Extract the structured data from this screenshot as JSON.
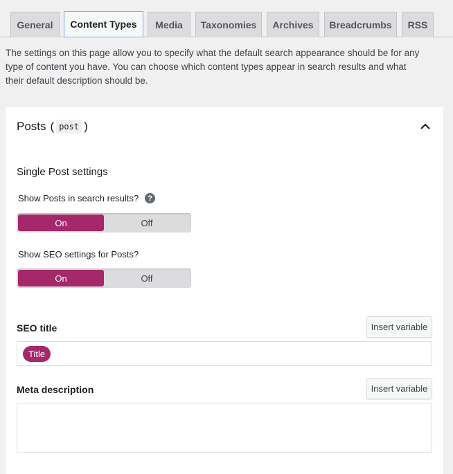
{
  "tabs": [
    {
      "label": "General",
      "active": false
    },
    {
      "label": "Content Types",
      "active": true
    },
    {
      "label": "Media",
      "active": false
    },
    {
      "label": "Taxonomies",
      "active": false
    },
    {
      "label": "Archives",
      "active": false
    },
    {
      "label": "Breadcrumbs",
      "active": false
    },
    {
      "label": "RSS",
      "active": false
    }
  ],
  "intro_text": "The settings on this page allow you to specify what the default search appearance should be for any type of content you have. You can choose which content types appear in search results and what their default description should be.",
  "card": {
    "title": "Posts",
    "title_open_paren": "(",
    "slug": "post",
    "title_close_paren": ")",
    "collapse_icon": "chevron-up-icon",
    "section_heading": "Single Post settings",
    "toggles": [
      {
        "label": "Show Posts in search results?",
        "has_help": true,
        "help_glyph": "?",
        "on_label": "On",
        "off_label": "Off",
        "value": "On"
      },
      {
        "label": "Show SEO settings for Posts?",
        "has_help": false,
        "on_label": "On",
        "off_label": "Off",
        "value": "On"
      }
    ],
    "seo_title": {
      "label": "SEO title",
      "insert_button": "Insert variable",
      "variables": [
        "Title"
      ]
    },
    "meta_description": {
      "label": "Meta description",
      "insert_button": "Insert variable",
      "value": ""
    }
  },
  "colors": {
    "accent": "#a4286a",
    "background": "#f0f0f1",
    "active_tab_border": "#72aee6"
  }
}
